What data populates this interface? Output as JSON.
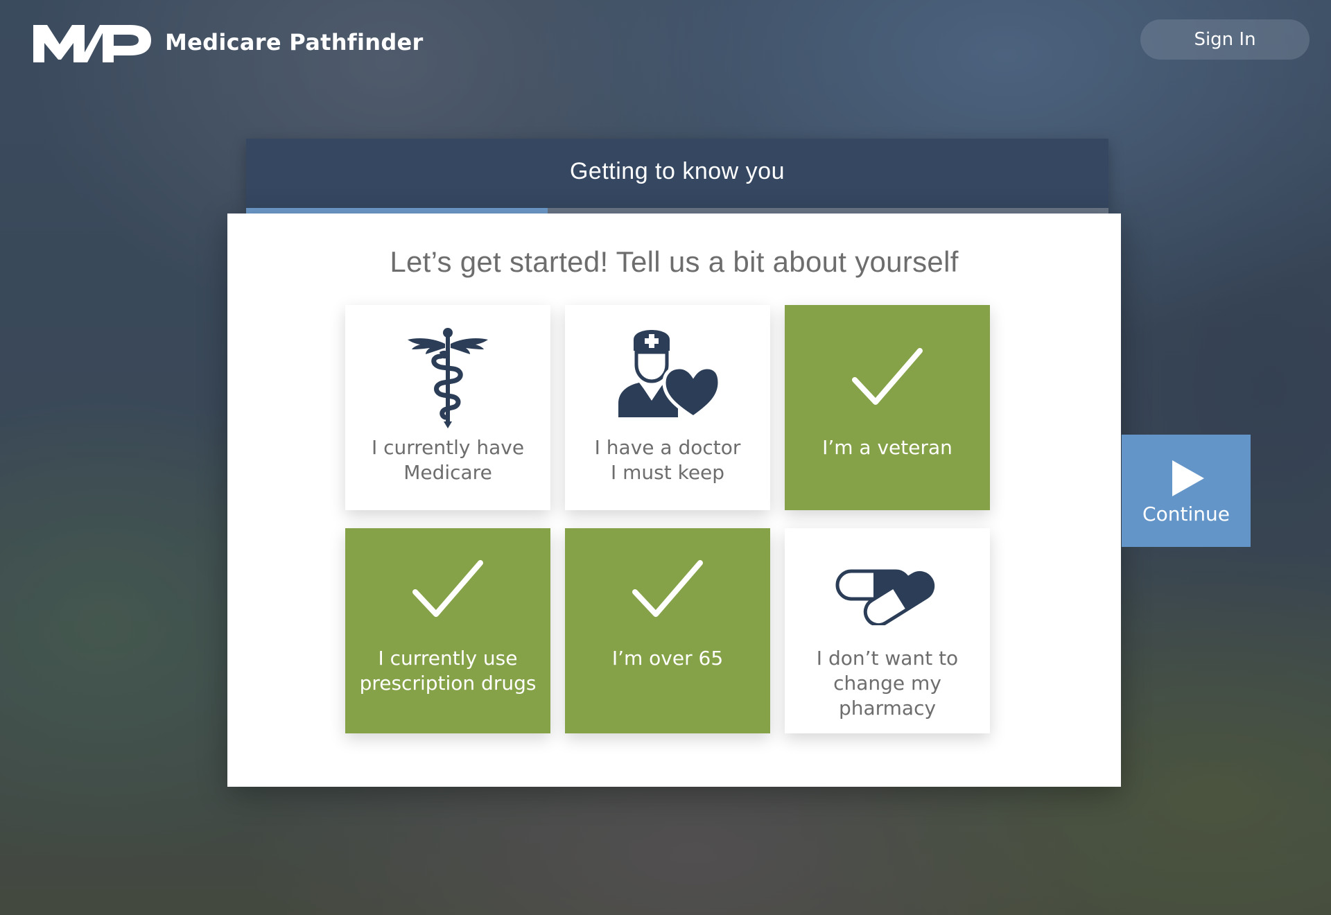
{
  "header": {
    "logo_text": "MP",
    "brand_name": "Medicare Pathfinder",
    "signin_label": "Sign In"
  },
  "stage": {
    "title": "Getting to know you",
    "progress_fraction": 0.35
  },
  "main": {
    "heading": "Let’s get started! Tell us a bit about yourself",
    "tiles": [
      {
        "label": "I currently have\nMedicare",
        "selected": false,
        "icon": "caduceus-icon"
      },
      {
        "label": "I have a doctor\nI must keep",
        "selected": false,
        "icon": "doctor-heart-icon"
      },
      {
        "label": "I’m a veteran",
        "selected": true,
        "icon": "checkmark-icon"
      },
      {
        "label": "I currently use\nprescription drugs",
        "selected": true,
        "icon": "checkmark-icon"
      },
      {
        "label": "I’m over 65",
        "selected": true,
        "icon": "checkmark-icon"
      },
      {
        "label": "I don’t want to\nchange my\npharmacy",
        "selected": false,
        "icon": "pills-icon"
      }
    ]
  },
  "continue": {
    "label": "Continue",
    "icon": "play-arrow-icon"
  },
  "colors": {
    "selected_tile": "#86a248",
    "continue": "#6495c8",
    "stage_header": "#354761",
    "progress": "#6f9ccd",
    "icon_navy": "#2c3e57"
  }
}
